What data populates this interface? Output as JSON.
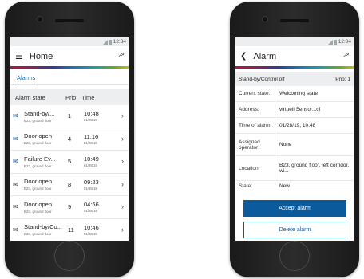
{
  "left": {
    "status": {
      "time": "12:34"
    },
    "header": {
      "title": "Home",
      "menu_icon": "hamburger-icon",
      "plug_icon": "plug-icon"
    },
    "tabs": [
      {
        "label": "Alarms"
      }
    ],
    "columns": {
      "state": "Alarm state",
      "prio": "Prio",
      "time": "Time"
    },
    "rows": [
      {
        "state": "Stand-by/...",
        "sub": "B23, ground floor",
        "prio": "1",
        "time": "10:48",
        "date": "01/28/19",
        "read": false
      },
      {
        "state": "Door open",
        "sub": "B23, ground floor",
        "prio": "4",
        "time": "11:16",
        "date": "01/28/19",
        "read": false
      },
      {
        "state": "Failure Ev...",
        "sub": "B23, ground floor",
        "prio": "5",
        "time": "10:49",
        "date": "01/28/19",
        "read": false
      },
      {
        "state": "Door open",
        "sub": "B23, ground floor",
        "prio": "8",
        "time": "09:23",
        "date": "01/28/19",
        "read": true
      },
      {
        "state": "Door open",
        "sub": "B23, ground floor",
        "prio": "9",
        "time": "04:56",
        "date": "01/28/19",
        "read": true
      },
      {
        "state": "Stand-by/Co...",
        "sub": "B23, ground floor",
        "prio": "11",
        "time": "10:46",
        "date": "01/28/19",
        "read": true
      }
    ]
  },
  "right": {
    "status": {
      "time": "12:34"
    },
    "header": {
      "title": "Alarm",
      "back_icon": "chevron-left-icon",
      "plug_icon": "plug-icon"
    },
    "summary": {
      "name": "Stand-by/Control off",
      "prio": "Prio: 1"
    },
    "details": [
      {
        "key": "Current state:",
        "value": "Welcoming state"
      },
      {
        "key": "Address:",
        "value": "virtuell.Sensor.1cf"
      },
      {
        "key": "Time of alarm:",
        "value": "01/28/19, 10.48"
      },
      {
        "key": "Assigned operator:",
        "value": "None"
      },
      {
        "key": "Location:",
        "value": "B23, ground floor, left corridor, wi..."
      },
      {
        "key": "State:",
        "value": "New"
      }
    ],
    "buttons": {
      "accept": "Accept alarm",
      "delete": "Delete alarm"
    }
  },
  "colors": {
    "accent": "#1a73b4",
    "primary_button": "#0b5a9c",
    "phone_body": "#1f1f1f"
  }
}
